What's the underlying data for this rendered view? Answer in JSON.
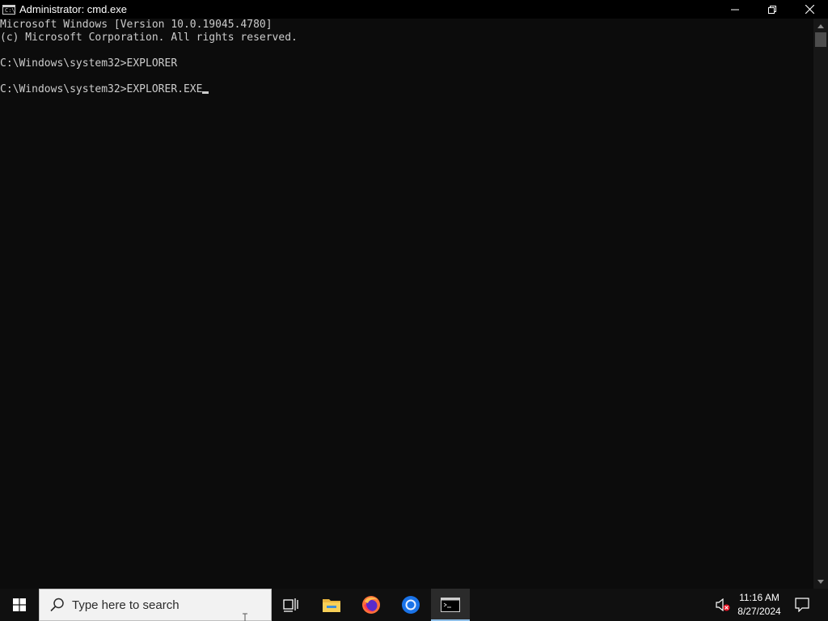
{
  "window": {
    "title": "Administrator: cmd.exe",
    "app_icon_text": "C:\\"
  },
  "console": {
    "lines": [
      "Microsoft Windows [Version 10.0.19045.4780]",
      "(c) Microsoft Corporation. All rights reserved.",
      "",
      "C:\\Windows\\system32>EXPLORER",
      "",
      "C:\\Windows\\system32>EXPLORER.EXE"
    ]
  },
  "taskbar": {
    "search_placeholder": "Type here to search",
    "apps": [
      {
        "name": "task-view",
        "icon": "task-view-icon"
      },
      {
        "name": "file-explorer",
        "icon": "folder-icon"
      },
      {
        "name": "firefox",
        "icon": "firefox-icon"
      },
      {
        "name": "chrome",
        "icon": "chrome-icon"
      },
      {
        "name": "cmd",
        "icon": "cmd-icon",
        "active": true
      }
    ],
    "clock": {
      "time": "11:16 AM",
      "date": "8/27/2024"
    },
    "volume": "muted"
  },
  "colors": {
    "console_bg": "#0c0c0c",
    "console_text": "#cccccc",
    "taskbar_bg": "#101010",
    "accent": "#8fbfe8"
  }
}
